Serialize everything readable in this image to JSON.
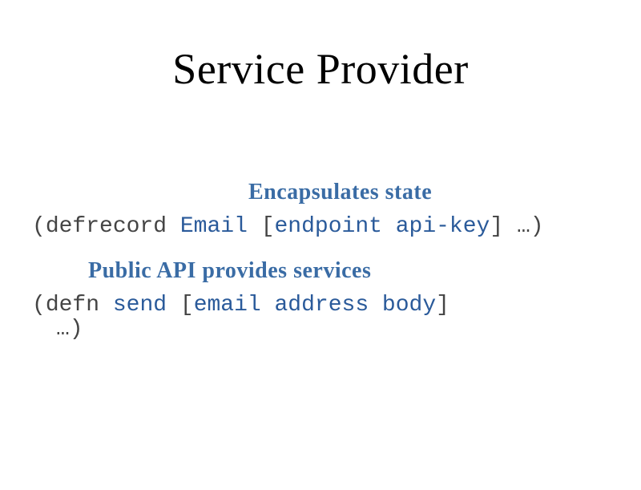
{
  "title": "Service Provider",
  "annotation1": "Encapsulates state",
  "annotation2": "Public API provides services",
  "code1": {
    "open": "(",
    "keyword": "defrecord",
    "space1": " ",
    "name": "Email",
    "space2": " ",
    "bopen": "[",
    "params": "endpoint api-key",
    "bclose": "]",
    "rest": " …)"
  },
  "code2": {
    "open": "(",
    "keyword": "defn",
    "space1": " ",
    "name": "send",
    "space2": " ",
    "bopen": "[",
    "params": "email address body",
    "bclose": "]"
  },
  "code3": {
    "text": "…)"
  }
}
